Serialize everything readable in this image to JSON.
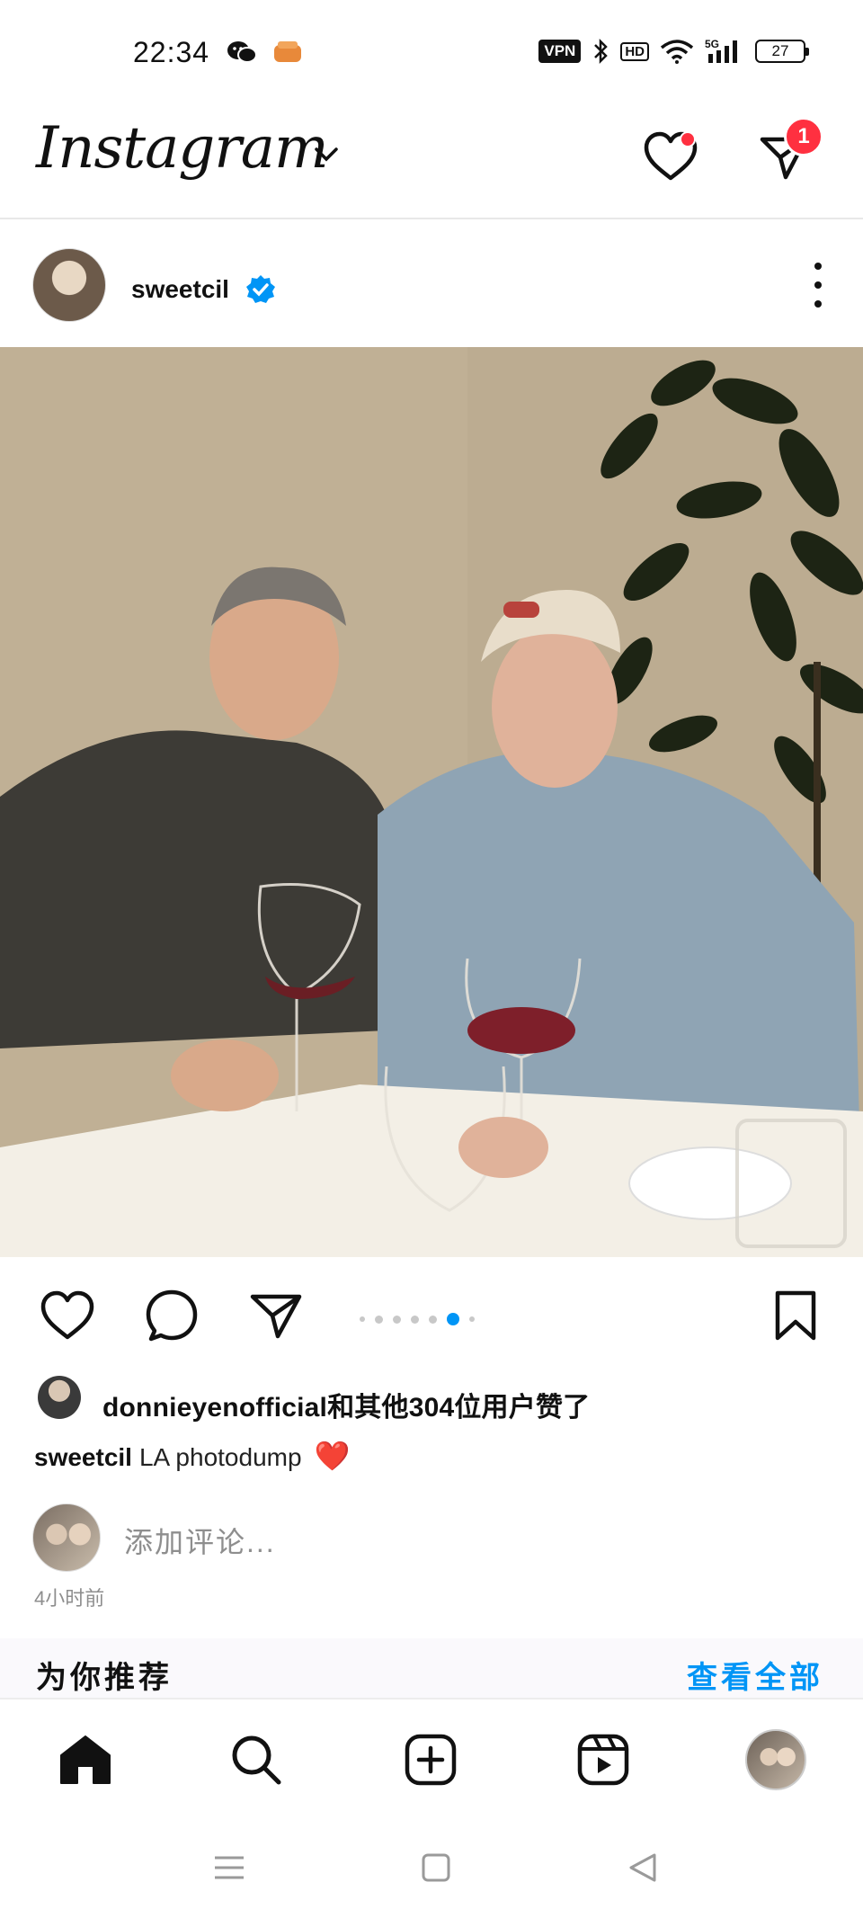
{
  "status_bar": {
    "time": "22:34",
    "vpn": "VPN",
    "hd": "HD",
    "network": "5G",
    "battery": "27"
  },
  "header": {
    "logo": "Instagram",
    "notification_badge": "1"
  },
  "post": {
    "username": "sweetcil",
    "likes_text": "donnieyenofficial和其他304位用户赞了",
    "caption_user": "sweetcil",
    "caption_text": "LA photodump",
    "caption_emoji": "❤️",
    "comment_placeholder": "添加评论...",
    "timestamp": "4小时前",
    "carousel_total": 7,
    "carousel_active": 6
  },
  "suggested": {
    "title": "为你推荐",
    "view_all": "查看全部"
  },
  "colors": {
    "accent": "#0095f6",
    "badge": "#ff3040",
    "heart": "#e3222e",
    "muted": "#8e8e8e"
  },
  "icons": {
    "header": [
      "heart-icon",
      "direct-message-icon"
    ],
    "actions": [
      "like-icon",
      "comment-icon",
      "share-icon",
      "save-icon"
    ],
    "nav": [
      "home-icon",
      "search-icon",
      "create-icon",
      "reels-icon",
      "profile-avatar"
    ],
    "system": [
      "menu-icon",
      "home-square-icon",
      "back-triangle-icon"
    ]
  }
}
